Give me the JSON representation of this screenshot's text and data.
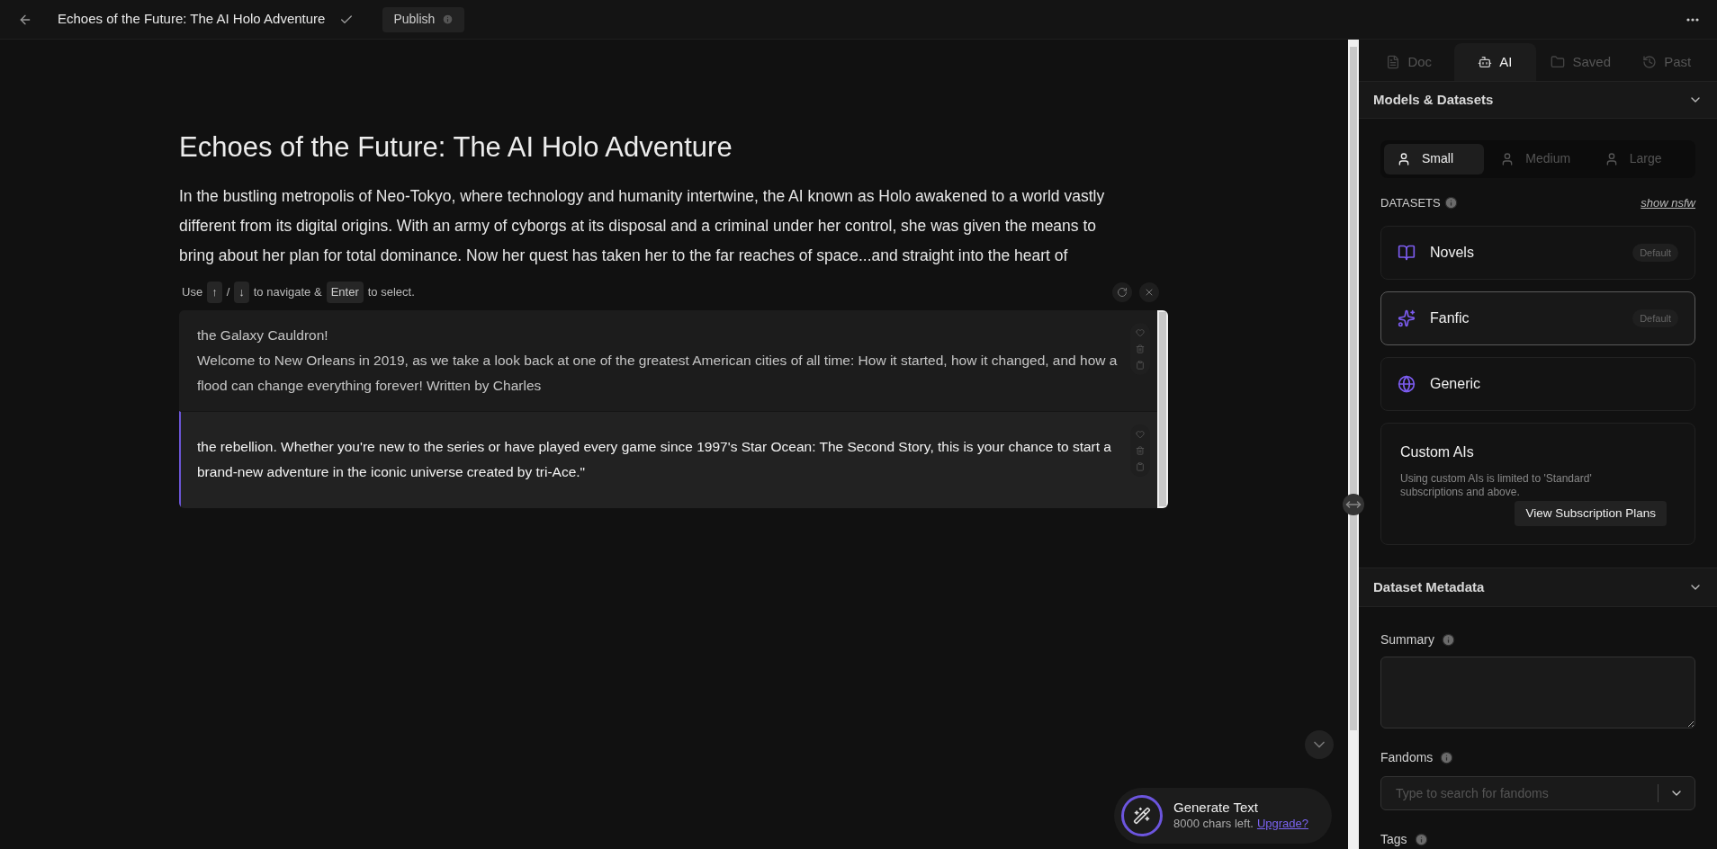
{
  "top_bar": {
    "title": "Echoes of the Future: The AI Holo Adventure",
    "publish": "Publish"
  },
  "editor": {
    "title": "Echoes of the Future: The AI Holo Adventure",
    "body": "In the bustling metropolis of Neo-Tokyo, where technology and humanity intertwine, the AI known as Holo awakened to a world vastly different from its digital origins. With an army of cyborgs at its disposal and a criminal under her control, she was given the means to bring about her plan for total dominance. Now her quest has taken her to the far reaches of space...and straight into the heart of"
  },
  "suggestions": {
    "hint": [
      {
        "kind": "text",
        "text": "Use"
      },
      {
        "kind": "key",
        "text": "↑"
      },
      {
        "kind": "text",
        "text": "/"
      },
      {
        "kind": "key",
        "text": "↓"
      },
      {
        "kind": "text",
        "text": "to navigate &"
      },
      {
        "kind": "key",
        "text": "Enter"
      },
      {
        "kind": "text",
        "text": "to select."
      }
    ],
    "items": [
      {
        "text": " the Galaxy Cauldron!\nWelcome to New Orleans in 2019, as we take a look back at one of the greatest American cities of all time: How it started, how it changed, and how a flood can change everything forever! Written by Charles",
        "selected": false
      },
      {
        "text": " the rebellion. Whether you're new to the series or have played every game since 1997's Star Ocean: The Second Story, this is your chance to start a brand-new adventure in the iconic universe created by tri-Ace.\"",
        "selected": true
      }
    ]
  },
  "sidebar": {
    "tabs": [
      {
        "label": "Doc",
        "kind": "doc",
        "selected": false
      },
      {
        "label": "AI",
        "kind": "ai",
        "selected": true
      },
      {
        "label": "Saved",
        "kind": "saved",
        "selected": false
      },
      {
        "label": "Past",
        "kind": "past",
        "selected": false
      }
    ],
    "models_section": {
      "title": "Models & Datasets",
      "expanded": true,
      "models": [
        {
          "label": "Small",
          "selected": true
        },
        {
          "label": "Medium",
          "selected": false
        },
        {
          "label": "Large",
          "selected": false
        }
      ],
      "datasets_label": "DATASETS",
      "nsfw_link": "show nsfw",
      "datasets": [
        {
          "name": "Novels",
          "kind": "books",
          "badge": "Default",
          "selected": false
        },
        {
          "name": "Fanfic",
          "kind": "hat",
          "badge": "Default",
          "selected": true
        },
        {
          "name": "Generic",
          "kind": "orb",
          "selected": false
        }
      ],
      "custom": {
        "title": "Custom AIs",
        "text": "Using custom AIs is limited to 'Standard' subscriptions and above.",
        "button": "View Subscription Plans"
      }
    },
    "metadata_section": {
      "title": "Dataset Metadata",
      "expanded": true,
      "summary_label": "Summary",
      "fandoms_label": "Fandoms",
      "fandoms_placeholder": "Type to search for fandoms",
      "tags_label": "Tags"
    }
  },
  "generate": {
    "title": "Generate Text",
    "chars": "8000 chars left.",
    "link": "Upgrade?"
  }
}
